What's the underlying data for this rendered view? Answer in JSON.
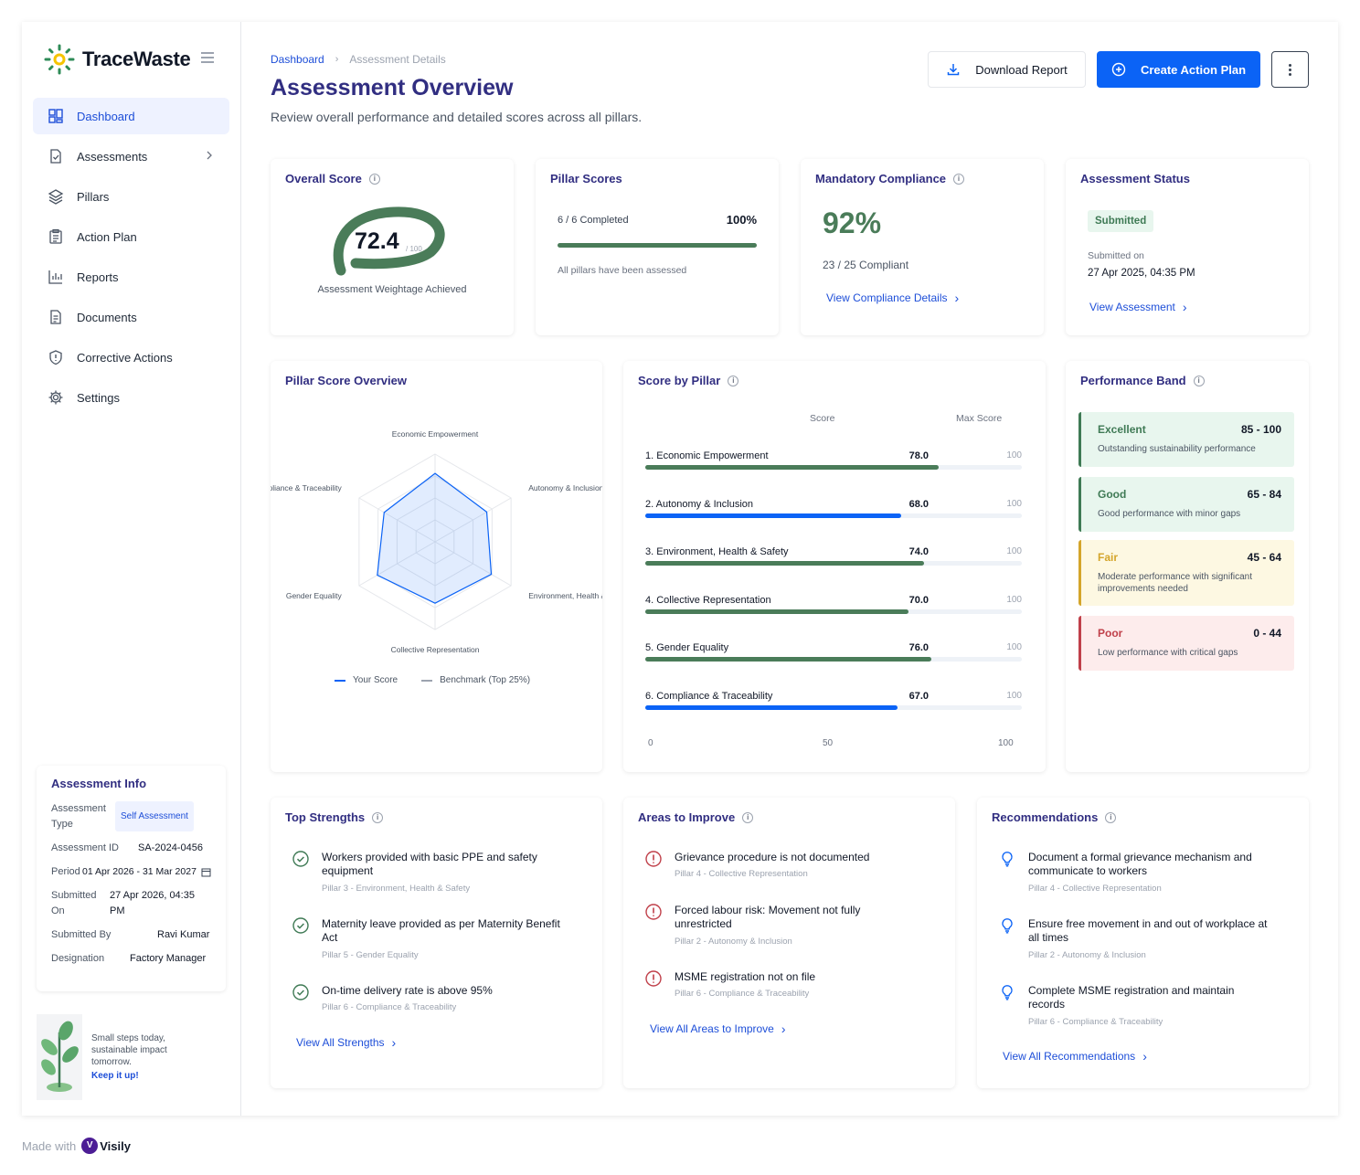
{
  "brand": {
    "name": "TraceWaste"
  },
  "nav": [
    {
      "label": "Dashboard",
      "icon": "grid-icon",
      "active": true
    },
    {
      "label": "Assessments",
      "icon": "clipboard-check-icon",
      "active": false
    },
    {
      "label": "Pillars",
      "icon": "layers-icon",
      "active": false
    },
    {
      "label": "Action Plan",
      "icon": "clipboard-list-icon",
      "active": false
    },
    {
      "label": "Reports",
      "icon": "bar-chart-icon",
      "active": false
    },
    {
      "label": "Documents",
      "icon": "document-icon",
      "active": false
    },
    {
      "label": "Corrective Actions",
      "icon": "shield-alert-icon",
      "active": false
    },
    {
      "label": "Settings",
      "icon": "gear-icon",
      "active": false
    }
  ],
  "assessment_info": {
    "title": "Assessment Info",
    "type_label": "Assessment Type",
    "type_value": "Self Assessment",
    "id_label": "Assessment ID",
    "id_value": "SA-2024-0456",
    "period_label": "Period",
    "period_value": "01 Apr 2026 - 31 Mar 2027",
    "submitted_on_label": "Submitted On",
    "submitted_on_value": "27 Apr 2026, 04:35 PM",
    "submitted_by_label": "Submitted By",
    "submitted_by_value": "Ravi Kumar",
    "designation_label": "Designation",
    "designation_value": "Factory Manager"
  },
  "promo": {
    "line1": "Small steps today,",
    "line2": "sustainable impact",
    "line3": "tomorrow.",
    "cta": "Keep it up!"
  },
  "header": {
    "breadcrumb_root": "Dashboard",
    "breadcrumb_current": "Assessment Details",
    "title": "Assessment Overview",
    "subtitle": "Review overall performance and detailed scores across all pillars.",
    "download_label": "Download Report",
    "create_label": "Create Action Plan"
  },
  "overall": {
    "title": "Overall Score",
    "score": "72.4",
    "of": "/ 100",
    "caption": "Assessment Weightage Achieved",
    "value": 72.4
  },
  "pillar_scores": {
    "title": "Pillar Scores",
    "completed": "6 / 6 Completed",
    "percent": "100%",
    "note": "All pillars have been assessed",
    "progress": 1.0
  },
  "compliance": {
    "title": "Mandatory Compliance",
    "percent": "92%",
    "detail": "23 / 25 Compliant",
    "link": "View Compliance Details"
  },
  "status": {
    "title": "Assessment Status",
    "badge": "Submitted",
    "submitted_label": "Submitted on",
    "submitted_value": "27 Apr 2025, 04:35 PM",
    "link": "View Assessment"
  },
  "radar": {
    "title": "Pillar Score Overview",
    "legend_you": "Your Score",
    "legend_bench": "Benchmark (Top 25%)"
  },
  "score_by_pillar": {
    "title": "Score by Pillar",
    "col_score": "Score",
    "col_max": "Max Score",
    "axis": [
      "0",
      "50",
      "100"
    ]
  },
  "chart_data": {
    "type": "bar",
    "categories": [
      "1. Economic Empowerment",
      "2. Autonomy & Inclusion",
      "3. Environment, Health & Safety",
      "4. Collective Representation",
      "5. Gender Equality",
      "6. Compliance & Traceability"
    ],
    "radar_labels": [
      "Economic Empowerment",
      "Autonomy & Inclusion",
      "Environment, Health & Safety",
      "Collective Representation",
      "Gender Equality",
      "Compliance & Traceability"
    ],
    "values": [
      78.0,
      68.0,
      74.0,
      70.0,
      76.0,
      67.0
    ],
    "value_labels": [
      "78.0",
      "68.0",
      "74.0",
      "70.0",
      "76.0",
      "67.0"
    ],
    "max_labels": [
      "100",
      "100",
      "100",
      "100",
      "100",
      "100"
    ],
    "max": 100,
    "bar_colors": [
      "#4a7c59",
      "#0b63f6",
      "#4a7c59",
      "#4a7c59",
      "#4a7c59",
      "#0b63f6"
    ],
    "ylim": [
      0,
      100
    ]
  },
  "performance_band": {
    "title": "Performance Band",
    "items": [
      {
        "name": "Excellent",
        "range": "85 - 100",
        "desc": "Outstanding sustainability performance",
        "color": "#3f7a55",
        "bg": "#e8f6ee"
      },
      {
        "name": "Good",
        "range": "65 - 84",
        "desc": "Good performance with minor gaps",
        "color": "#3f7a55",
        "bg": "#e8f6ee"
      },
      {
        "name": "Fair",
        "range": "45 - 64",
        "desc": "Moderate performance with significant improvements needed",
        "color": "#d4a52b",
        "bg": "#fdf8e2"
      },
      {
        "name": "Poor",
        "range": "0 - 44",
        "desc": "Low performance with critical gaps",
        "color": "#c0404a",
        "bg": "#fdecec"
      }
    ]
  },
  "strengths": {
    "title": "Top Strengths",
    "items": [
      {
        "text": "Workers provided with basic PPE and safety equipment",
        "sub": "Pillar 3 - Environment, Health & Safety"
      },
      {
        "text": "Maternity leave provided as per Maternity Benefit Act",
        "sub": "Pillar 5 - Gender Equality"
      },
      {
        "text": "On-time delivery rate is above 95%",
        "sub": "Pillar 6 - Compliance & Traceability"
      }
    ],
    "link": "View All Strengths"
  },
  "improve": {
    "title": "Areas to Improve",
    "items": [
      {
        "text": "Grievance procedure is not documented",
        "sub": "Pillar 4 - Collective Representation"
      },
      {
        "text": "Forced labour risk: Movement not fully unrestricted",
        "sub": "Pillar 2 - Autonomy & Inclusion"
      },
      {
        "text": "MSME registration not on file",
        "sub": "Pillar 6 - Compliance & Traceability"
      }
    ],
    "link": "View All Areas to Improve"
  },
  "recommendations": {
    "title": "Recommendations",
    "items": [
      {
        "text": "Document a formal grievance mechanism and communicate to workers",
        "sub": "Pillar 4 - Collective Representation"
      },
      {
        "text": "Ensure free movement in and out of workplace at all times",
        "sub": "Pillar 2 - Autonomy & Inclusion"
      },
      {
        "text": "Complete MSME registration and maintain records",
        "sub": "Pillar 6 - Compliance & Traceability"
      }
    ],
    "link": "View All Recommendations"
  },
  "footer": {
    "made_with": "Made with",
    "brand": "Visily"
  }
}
